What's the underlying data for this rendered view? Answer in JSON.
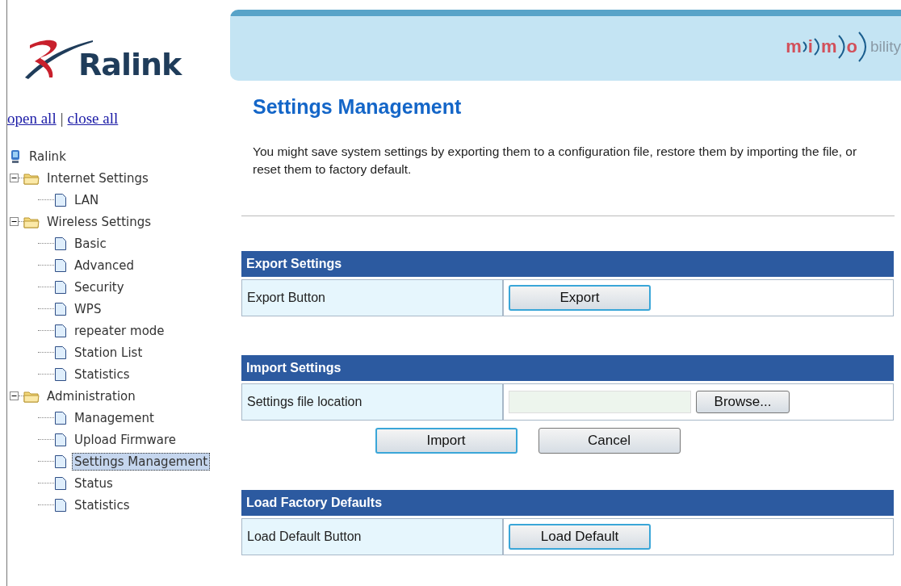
{
  "logo": {
    "brand": "Ralink"
  },
  "banner": {
    "letters": [
      "m",
      "i",
      "m",
      "o"
    ],
    "suffix": "bility"
  },
  "sidebar": {
    "links": [
      "open all",
      "close all"
    ],
    "separator": "|",
    "tree": {
      "label": "Ralink",
      "children": [
        {
          "label": "Internet Settings",
          "expanded": true,
          "selected": false,
          "children": [
            {
              "label": "LAN",
              "selected": false
            }
          ]
        },
        {
          "label": "Wireless Settings",
          "expanded": true,
          "selected": false,
          "children": [
            {
              "label": "Basic",
              "selected": false
            },
            {
              "label": "Advanced",
              "selected": false
            },
            {
              "label": "Security",
              "selected": false
            },
            {
              "label": "WPS",
              "selected": false
            },
            {
              "label": "repeater mode",
              "selected": false
            },
            {
              "label": "Station List",
              "selected": false
            },
            {
              "label": "Statistics",
              "selected": false
            }
          ]
        },
        {
          "label": "Administration",
          "expanded": true,
          "selected": false,
          "children": [
            {
              "label": "Management",
              "selected": false
            },
            {
              "label": "Upload Firmware",
              "selected": false
            },
            {
              "label": "Settings Management",
              "selected": true
            },
            {
              "label": "Status",
              "selected": false
            },
            {
              "label": "Statistics",
              "selected": false
            }
          ]
        }
      ]
    }
  },
  "page": {
    "title": "Settings Management",
    "description": "You might save system settings by exporting them to a configuration file, restore them by importing the file, or reset them to factory default."
  },
  "sections": [
    {
      "title": "Export Settings",
      "rows": [
        {
          "label": "Export Button",
          "kind": "button",
          "button": {
            "label": "Export",
            "highlighted": true
          }
        }
      ]
    },
    {
      "title": "Import Settings",
      "rows": [
        {
          "label": "Settings file location",
          "kind": "file",
          "button": {
            "label": "Browse...",
            "highlighted": false
          }
        }
      ],
      "actions": [
        {
          "label": "Import",
          "highlighted": true
        },
        {
          "label": "Cancel",
          "highlighted": false
        }
      ]
    },
    {
      "title": "Load Factory Defaults",
      "rows": [
        {
          "label": "Load Default Button",
          "kind": "button",
          "button": {
            "label": "Load Default",
            "highlighted": true
          }
        }
      ]
    }
  ]
}
